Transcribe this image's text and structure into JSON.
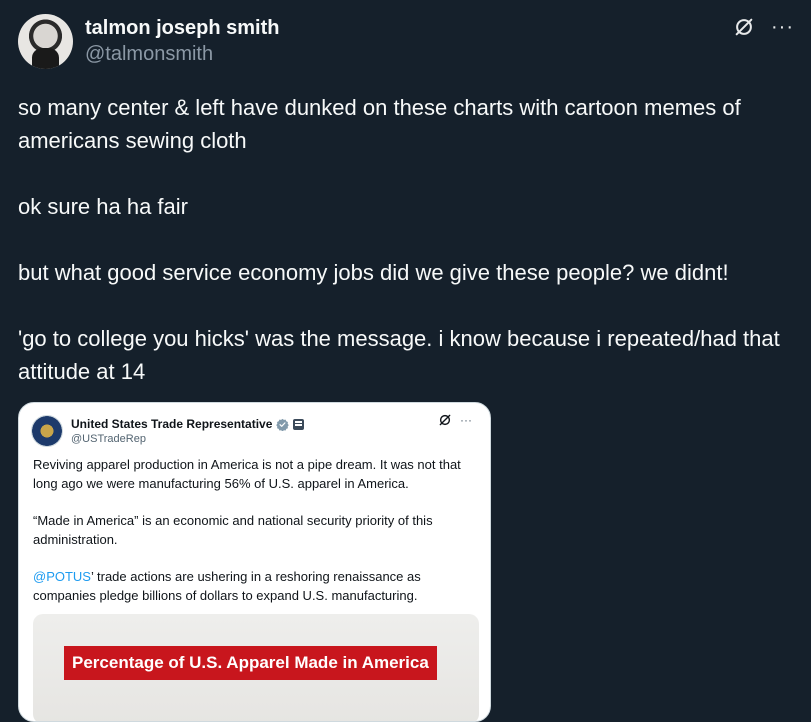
{
  "tweet": {
    "display_name": "talmon joseph smith",
    "handle": "@talmonsmith",
    "paragraphs": [
      "so many center & left have dunked on these charts with cartoon memes of americans sewing cloth",
      "ok sure ha ha fair",
      "but what good service economy jobs did we give these people? we didnt!",
      "'go to college you hicks' was the message. i know because i repeated/had that attitude at 14"
    ],
    "more_label": "···",
    "icons": {
      "avatar": "profile-photo",
      "grok": "grok-icon",
      "more": "more-icon"
    }
  },
  "quote": {
    "display_name": "United States Trade Representative",
    "handle": "@USTradeRep",
    "more_label": "···",
    "paragraph1": "Reviving apparel production in America is not a pipe dream. It was not that long ago we were manufacturing 56% of U.S. apparel in America.",
    "paragraph2": "“Made in America” is an economic and national security priority of this administration.",
    "paragraph3_mention": "@POTUS",
    "paragraph3_rest": "’ trade actions are ushering in a reshoring renaissance as companies pledge billions of dollars to expand U.S. manufacturing.",
    "image_title": "Percentage of U.S. Apparel Made in America",
    "colors": {
      "verified": "#829aab",
      "link": "#1d9bf0",
      "banner": "#c8161d"
    },
    "icons": {
      "avatar": "agency-seal",
      "verified": "verified-badge-icon",
      "affiliate": "flag-icon"
    }
  }
}
